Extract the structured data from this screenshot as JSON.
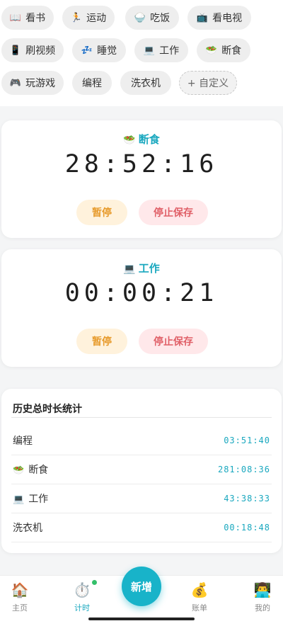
{
  "chips": [
    {
      "icon": "📖",
      "label": "看书"
    },
    {
      "icon": "🏃",
      "label": "运动"
    },
    {
      "icon": "🍚",
      "label": "吃饭"
    },
    {
      "icon": "📺",
      "label": "看电视"
    },
    {
      "icon": "📱",
      "label": "刷视频"
    },
    {
      "icon": "💤",
      "label": "睡觉"
    },
    {
      "icon": "💻",
      "label": "工作"
    },
    {
      "icon": "🥗",
      "label": "断食"
    },
    {
      "icon": "🎮",
      "label": "玩游戏"
    },
    {
      "icon": "",
      "label": "编程"
    },
    {
      "icon": "",
      "label": "洗衣机"
    },
    {
      "icon": "",
      "label": "+ 自定义"
    }
  ],
  "timers": [
    {
      "icon": "🥗",
      "name": "断食",
      "time": "28:52:16",
      "pause_label": "暂停",
      "stop_label": "停止保存"
    },
    {
      "icon": "💻",
      "name": "工作",
      "time": "00:00:21",
      "pause_label": "暂停",
      "stop_label": "停止保存"
    }
  ],
  "history": {
    "title": "历史总时长统计",
    "rows": [
      {
        "icon": "",
        "name": "编程",
        "duration": "03:51:40"
      },
      {
        "icon": "🥗",
        "name": "断食",
        "duration": "281:08:36"
      },
      {
        "icon": "💻",
        "name": "工作",
        "duration": "43:38:33"
      },
      {
        "icon": "",
        "name": "洗衣机",
        "duration": "00:18:48"
      }
    ]
  },
  "nav": {
    "home": {
      "icon": "🏠",
      "label": "主页"
    },
    "timer": {
      "icon": "⏱️",
      "label": "计时"
    },
    "add": {
      "label": "新增"
    },
    "bill": {
      "icon": "💰",
      "label": "账单"
    },
    "mine": {
      "icon": "👨‍💻",
      "label": "我的"
    }
  },
  "colors": {
    "accent": "#18b3c9",
    "pause": "#e79a2a",
    "stop": "#e06068"
  }
}
